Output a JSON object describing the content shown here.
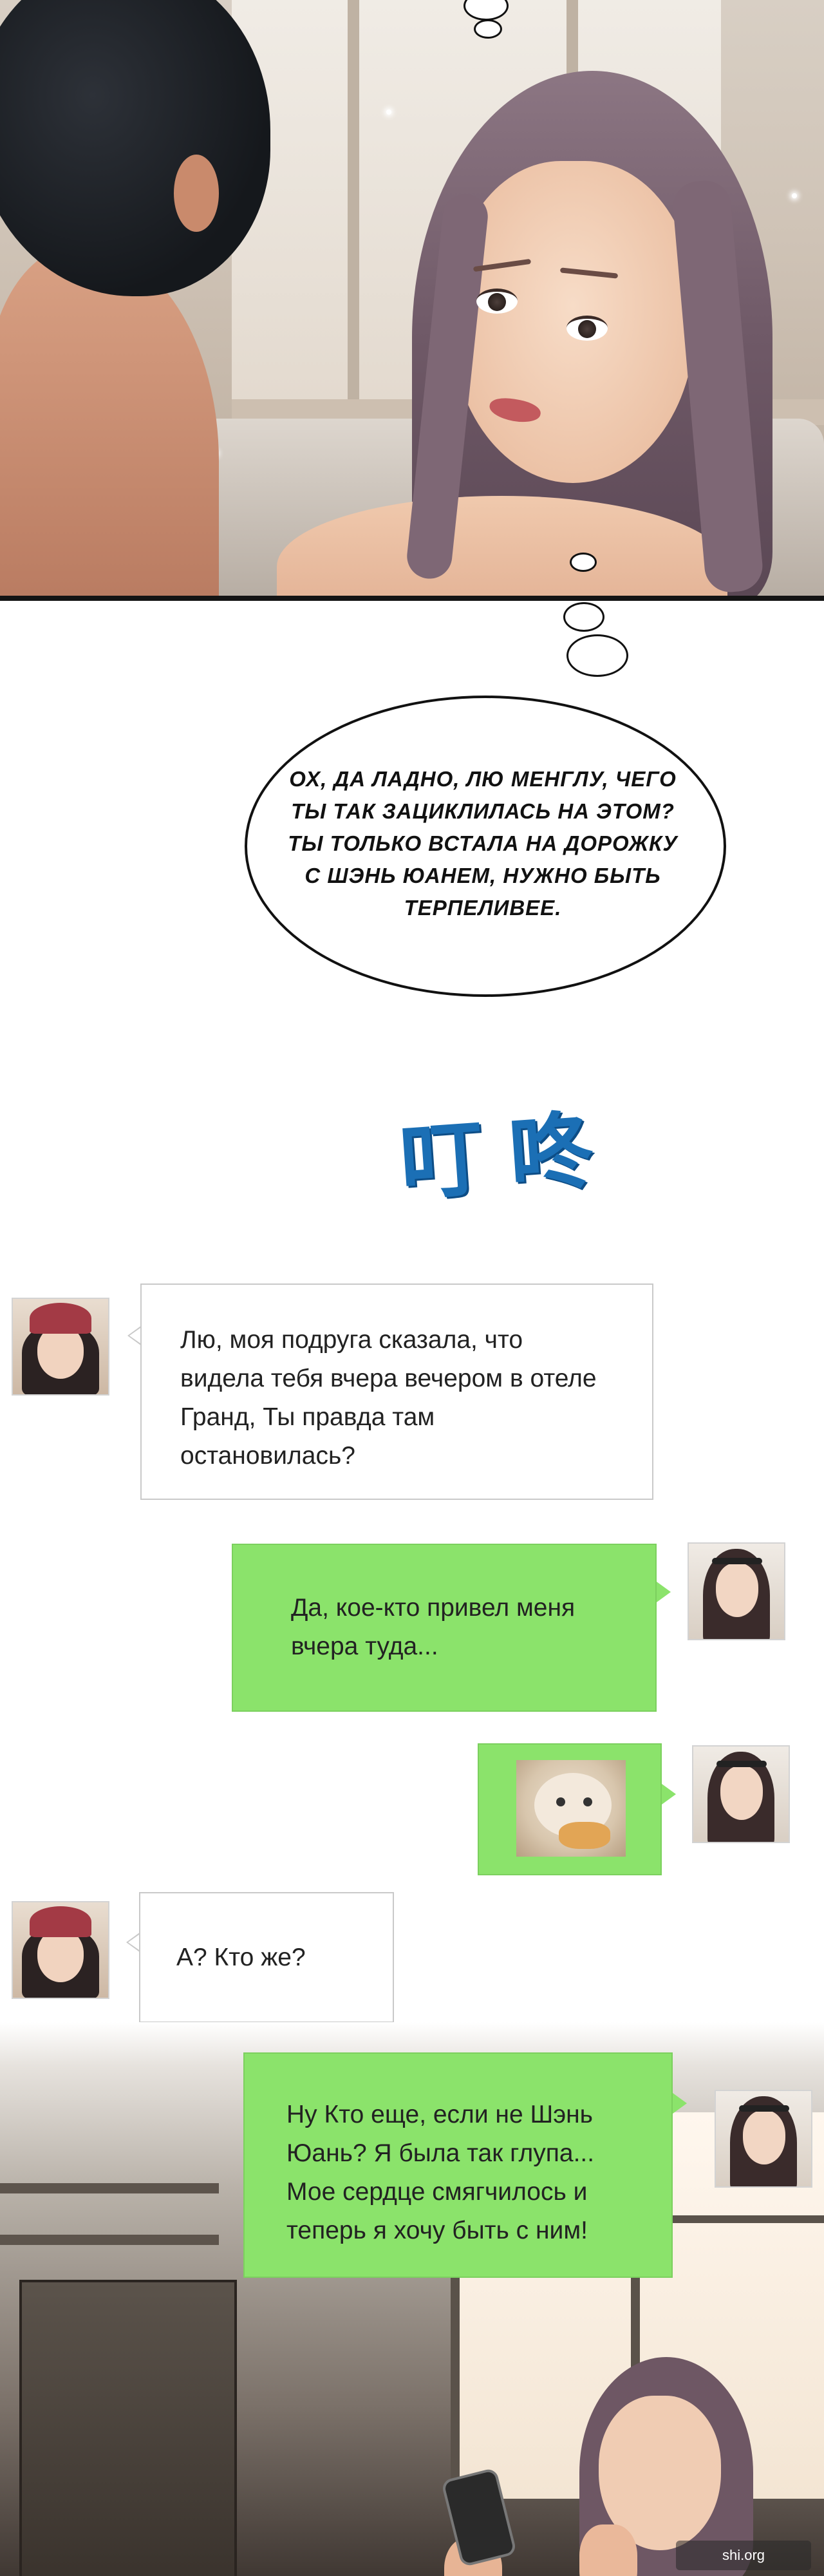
{
  "panel_top": {
    "scene": "top-illustration"
  },
  "speech_bubble": {
    "text": "ОХ, ДА ЛАДНО, ЛЮ МЕНГЛУ, ЧЕГО ТЫ ТАК ЗАЦИКЛИЛАСЬ НА ЭТОМ? ТЫ ТОЛЬКО ВСТАЛА НА ДОРОЖКУ С ШЭНЬ ЮАНЕМ, НУЖНО БЫТЬ ТЕРПЕЛИВЕЕ."
  },
  "sfx": {
    "text": "叮咚"
  },
  "chat": {
    "messages": [
      {
        "sender": "friend",
        "text": "Лю, моя подруга сказала, что видела тебя вчера вечером в отеле Гранд, Ты правда там остановилась?"
      },
      {
        "sender": "me",
        "text": "Да, кое-кто привел меня вчера туда..."
      },
      {
        "sender": "me",
        "image": "cat-meme"
      },
      {
        "sender": "friend",
        "text": "А? Кто же?"
      },
      {
        "sender": "me",
        "text": "Ну Кто еще, если не Шэнь Юань? Я была так глупа... Мое сердце смягчилось и теперь я хочу быть с ним!"
      }
    ]
  },
  "colors": {
    "green_bubble": "#8be36b",
    "white_bubble": "#ffffff",
    "sfx_blue": "#1b6fb5"
  },
  "watermark": {
    "text": "shi.org"
  }
}
